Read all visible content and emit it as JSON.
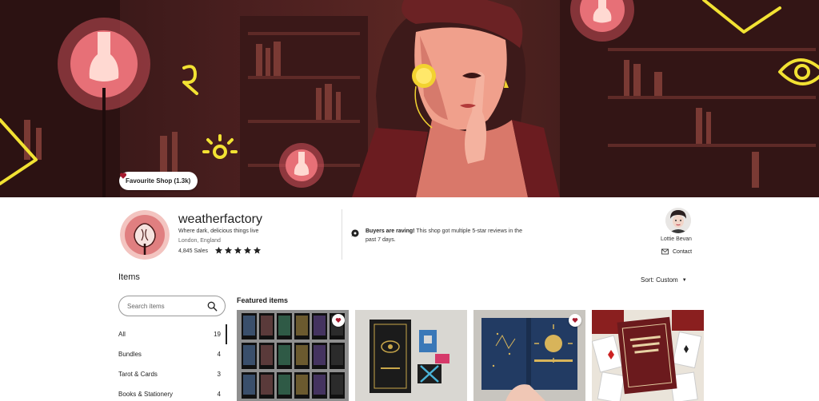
{
  "banner": {
    "favourite_label": "Favourite Shop (1.3k)"
  },
  "shop": {
    "name": "weatherfactory",
    "tagline": "Where dark, delicious things live",
    "location": "London, England",
    "sales": "4,845 Sales",
    "rating_stars": 5
  },
  "notice": {
    "bold": "Buyers are raving!",
    "text": " This shop got multiple 5-star reviews in the past 7 days."
  },
  "owner": {
    "name": "Lottie Bevan",
    "contact_label": "Contact"
  },
  "items": {
    "heading": "Items",
    "sort_label": "Sort: Custom",
    "search_placeholder": "Search items",
    "categories": [
      {
        "label": "All",
        "count": "19"
      },
      {
        "label": "Bundles",
        "count": "4"
      },
      {
        "label": "Tarot & Cards",
        "count": "3"
      },
      {
        "label": "Books & Stationery",
        "count": "4"
      }
    ],
    "featured_heading": "Featured items"
  },
  "colors": {
    "accent_heart": "#a61a2e",
    "star": "#222222"
  },
  "icons": {
    "heart": "heart-icon",
    "search": "search-icon",
    "chat": "chat-icon",
    "mail": "mail-icon",
    "caret": "caret-down-icon",
    "star": "star-icon"
  }
}
